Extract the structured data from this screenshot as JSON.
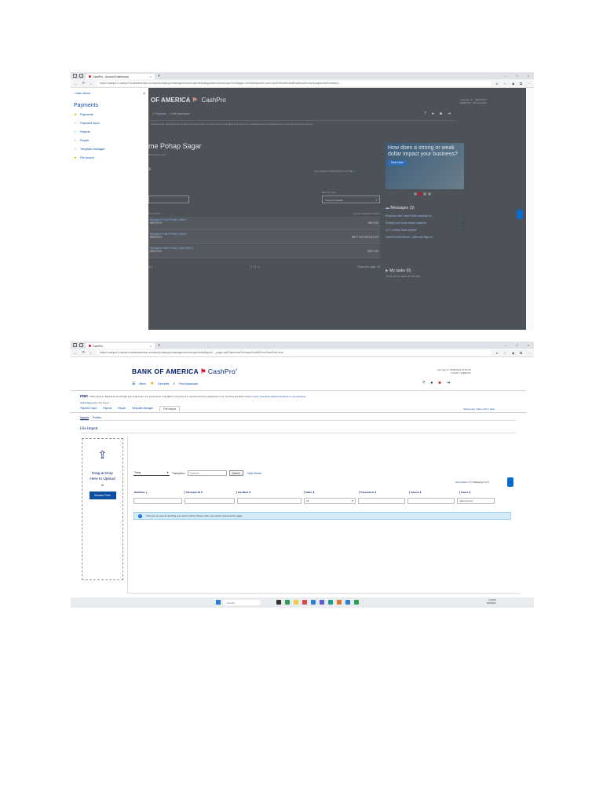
{
  "shot1": {
    "browser": {
      "tab_title": "CashPro - Account Dashboard",
      "url": "https://cashpro1.cashpro.bankofamerica.com/cpe/portal/cppmmanager/service/cpe/default/guid/cbm/Dashboard?cntMsgId=cbmDashboardCcach=&IsRefreshDefaultDashboard=true&paymentsSummary=..."
    },
    "side_menu": {
      "back_label": "Main Menu",
      "close": "×",
      "heading": "Payments",
      "items": [
        {
          "label": "Payments",
          "starred": true
        },
        {
          "label": "Payment Input",
          "starred": false
        },
        {
          "label": "Rejects",
          "starred": false
        },
        {
          "label": "Repair",
          "starred": false
        },
        {
          "label": "Template Manager",
          "starred": false
        },
        {
          "label": "File Import",
          "starred": true
        }
      ]
    },
    "background": {
      "brand": "OF AMERICA",
      "product": "CashPro",
      "favorites": "Favorites",
      "find_transaction": "Find transaction",
      "welcome": "me Pohap Sagar",
      "subtitle": "ation 1 hour ago",
      "section": "s",
      "last_updated": "Last Updated: 06/06/2023 01:25 PM",
      "balance_view_label": "Balance View",
      "balance_view_value": "Current Available",
      "col_left": "ount Name",
      "col_right": "Current available balance",
      "rows": [
        {
          "name": "Bangalore India Private Limited",
          "sub": "INR/XXXX",
          "amount": "INR 0.00"
        },
        {
          "name": "Bangalore India Private Limited",
          "sub": "INR/XXXX",
          "amount": "INR 7 XX,XXX,XXX.XX"
        },
        {
          "name": "Bangalore India Private Limited (NRI)",
          "sub": "INR/XXXX",
          "amount": "USD 0.00"
        }
      ],
      "pager_left": "of 1",
      "pager_mid": "1",
      "pager_right": "Rows per page: 25",
      "ad_text": "How does a strong or weak dollar impact your business?",
      "ad_button": "See how",
      "messages_title": "Messages (3)",
      "messages": [
        "Regional India / Asia Pacific banking hol...",
        "Simplify your cross-border payment",
        "U.S. Holiday Hours Update",
        "CashPro with Secure – Alternate Sign-on"
      ],
      "tasks_title": "My tasks (0)",
      "tasks_empty": "There are no tasks at this time."
    }
  },
  "shot2": {
    "browser": {
      "tab_title": "CashPro",
      "url": "https://cashpro1.cashpro.bankofamerica.com/cpe/portal/cppmmanager/service/cpe/default/guid/..._page=cpbPaymentsFileImportList&isForceNewGuid=true"
    },
    "header": {
      "brand_left": "BANK OF AMERICA",
      "product": "CashPro",
      "last_signin": "Last Sign In: 06/06/2023 13:45 IST",
      "user_line": "POHAP • SNBNXXX",
      "menu": "Menu",
      "favorites": "Favorites",
      "find_transaction": "Find transaction"
    },
    "fdic": {
      "logo": "FDIC",
      "text": "FDIC-Insured - Backed by the full faith and credit of the U.S. Government. Only Bank of America, N.A. deposit accounts maintained in U.S. branches are FDIC-insured.",
      "link": "Learn more about deposit insurance on your accounts."
    },
    "breadcrumb": {
      "root": "Global Payments",
      "sep": "/",
      "current": "File Import"
    },
    "subnav": [
      "Payment Input",
      "Rejects",
      "Repair",
      "Template Manager",
      "File Import"
    ],
    "prefs": "Preferences  |  Take a Tour  |  Help",
    "tabs": [
      "Imports",
      "Profiles"
    ],
    "title": "File Import",
    "dropzone": {
      "line1": "Drag & Drop",
      "line2": "Here to Upload",
      "or": "or",
      "browse": "Browse Files"
    },
    "filters": {
      "period": "Today",
      "transaction_label": "Transaction",
      "transaction_placeholder": "Optional",
      "search": "Search",
      "clear_search": "Clear Search",
      "clear_filters": "Clear Filters",
      "displaying": "Displaying 0 of 0"
    },
    "columns": [
      "Date/Time",
      "File Import ID",
      "File Name",
      "Status",
      "Transactions",
      "Amount",
      "Source"
    ],
    "status_value": "All",
    "source_value": "Select Source",
    "no_records": "There are no records matching your search criteria. Please refine your search criteria and try again.",
    "taskbar": {
      "search": "Search",
      "time": "1:26 PM",
      "date": "6/06/2023"
    }
  },
  "colors": {
    "brand_navy": "#012169",
    "brand_red": "#dc1431",
    "link_blue": "#0b4ea2",
    "info_bg": "#d4ecfa"
  }
}
